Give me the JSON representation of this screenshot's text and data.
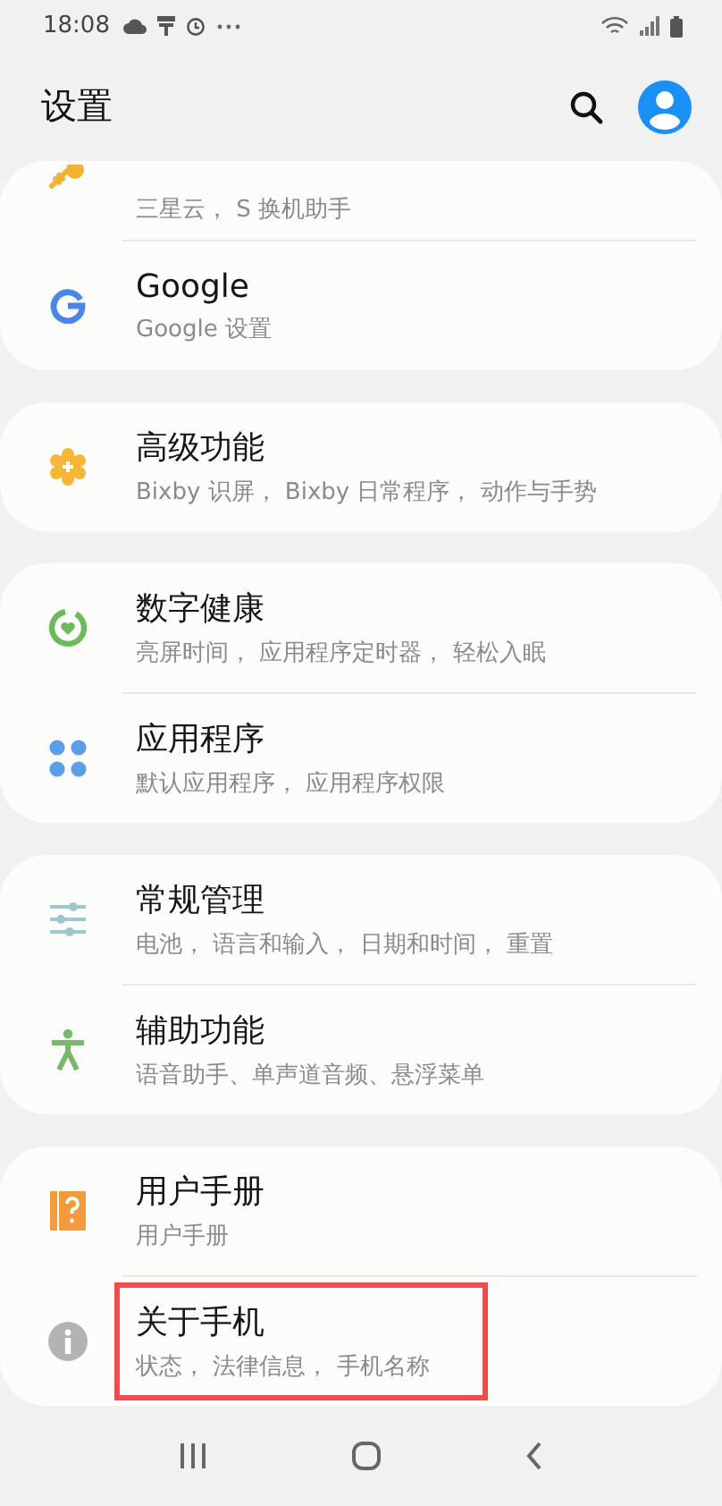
{
  "status_bar": {
    "time": "18:08"
  },
  "header": {
    "title": "设置"
  },
  "groups": [
    {
      "items": [
        {
          "kind": "key",
          "subtitle": "三星云， S 换机助手",
          "highlighted": false
        },
        {
          "kind": "google",
          "title": "Google",
          "subtitle": "Google 设置",
          "highlighted": false
        }
      ]
    },
    {
      "items": [
        {
          "kind": "advanced",
          "title": "高级功能",
          "subtitle": "Bixby 识屏， Bixby 日常程序， 动作与手势",
          "highlighted": false
        }
      ]
    },
    {
      "items": [
        {
          "kind": "wellbeing",
          "title": "数字健康",
          "subtitle": "亮屏时间， 应用程序定时器， 轻松入眠",
          "highlighted": false
        },
        {
          "kind": "apps",
          "title": "应用程序",
          "subtitle": "默认应用程序， 应用程序权限",
          "highlighted": false
        }
      ]
    },
    {
      "items": [
        {
          "kind": "sliders",
          "title": "常规管理",
          "subtitle": "电池， 语言和输入， 日期和时间， 重置",
          "highlighted": false
        },
        {
          "kind": "accessibility",
          "title": "辅助功能",
          "subtitle": "语音助手、单声道音频、悬浮菜单",
          "highlighted": false
        }
      ]
    },
    {
      "items": [
        {
          "kind": "manual",
          "title": "用户手册",
          "subtitle": "用户手册",
          "highlighted": false
        },
        {
          "kind": "info",
          "title": "关于手机",
          "subtitle": "状态， 法律信息， 手机名称",
          "highlighted": true
        }
      ]
    }
  ]
}
